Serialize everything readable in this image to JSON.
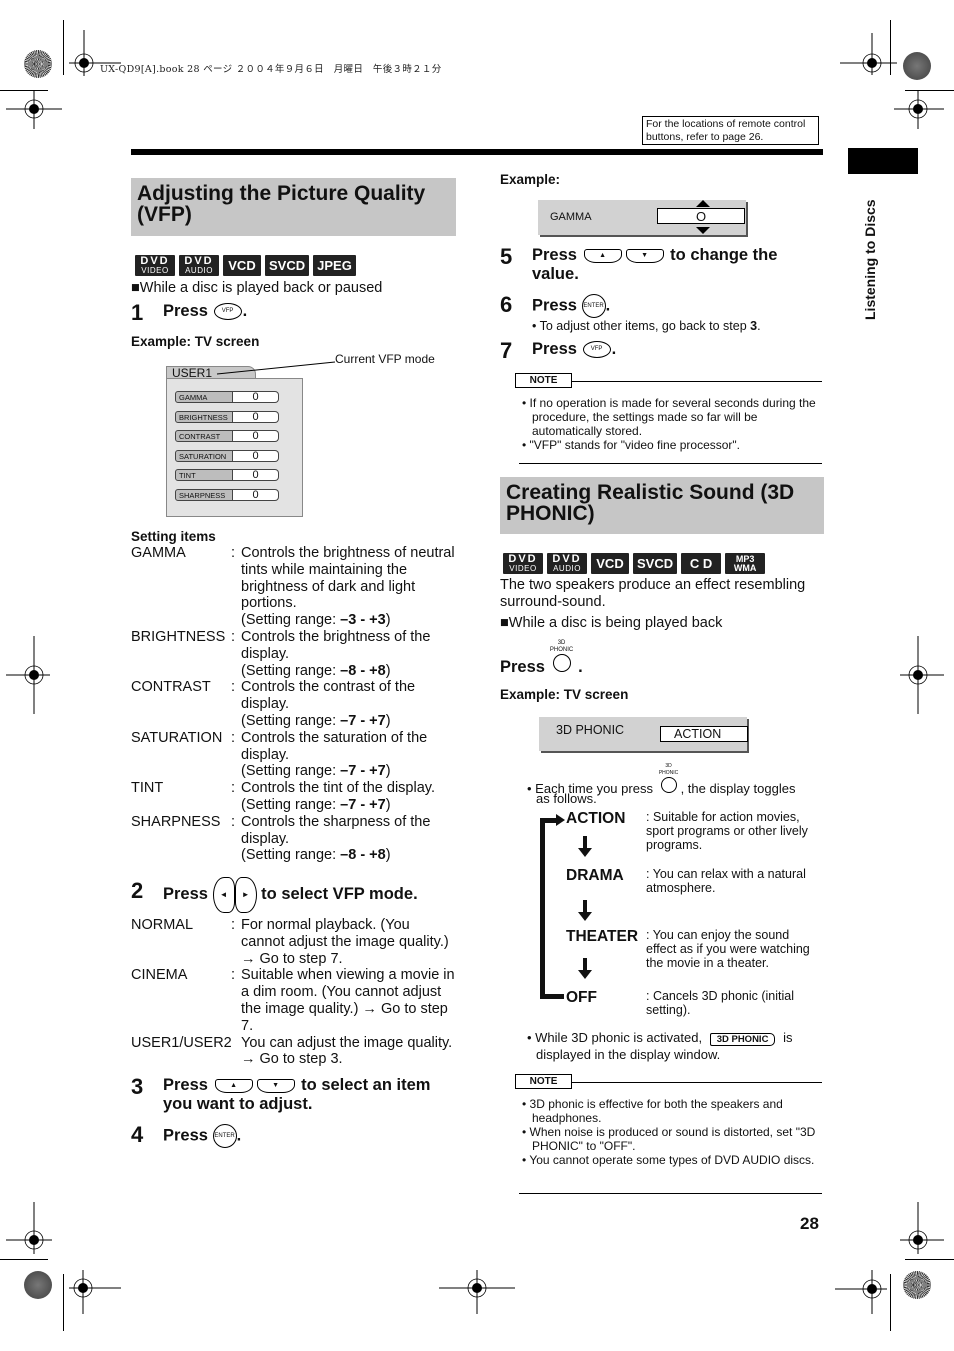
{
  "print_header": "UX-QD9[A].book  28 ページ  ２００４年９月６日　月曜日　午後３時２１分",
  "ref_note": "For the locations of remote control buttons, refer to page 26.",
  "side_label": "Listening to Discs",
  "page_number": "28",
  "vfp": {
    "title": "Adjusting the Picture Quality (VFP)",
    "disc_badges": [
      {
        "top": "DVD",
        "bottom": "VIDEO"
      },
      {
        "top": "DVD",
        "bottom": "AUDIO"
      },
      {
        "label": "VCD"
      },
      {
        "label": "SVCD"
      },
      {
        "label": "JPEG"
      }
    ],
    "condition": "■While a disc is played back or paused",
    "step1": {
      "num": "1",
      "pre": "Press",
      "button": "VFP",
      "post": "."
    },
    "example_label": "Example: TV screen",
    "tv_screen": {
      "mode": "USER1",
      "callout": "Current VFP mode",
      "rows": [
        {
          "name": "GAMMA",
          "value": "0"
        },
        {
          "name": "BRIGHTNESS",
          "value": "0"
        },
        {
          "name": "CONTRAST",
          "value": "0"
        },
        {
          "name": "SATURATION",
          "value": "0"
        },
        {
          "name": "TINT",
          "value": "0"
        },
        {
          "name": "SHARPNESS",
          "value": "0"
        }
      ]
    },
    "setting_items_heading": "Setting items",
    "setting_items": [
      {
        "name": "GAMMA",
        "desc": "Controls the brightness of neutral tints while maintaining the brightness of dark and light portions.",
        "range_prefix": "(Setting range: ",
        "range": "–3 - +3",
        "range_suffix": ")"
      },
      {
        "name": "BRIGHTNESS",
        "desc": "Controls the brightness of the display.",
        "range_prefix": "(Setting range: ",
        "range": "–8 - +8",
        "range_suffix": ")"
      },
      {
        "name": "CONTRAST",
        "desc": "Controls the contrast of the display.",
        "range_prefix": "(Setting range: ",
        "range": "–7 - +7",
        "range_suffix": ")"
      },
      {
        "name": "SATURATION",
        "desc": "Controls the saturation of the display.",
        "range_prefix": "(Setting range: ",
        "range": "–7 - +7",
        "range_suffix": ")"
      },
      {
        "name": "TINT",
        "desc": "Controls the tint of the display.",
        "range_prefix": "(Setting range: ",
        "range": "–7 - +7",
        "range_suffix": ")"
      },
      {
        "name": "SHARPNESS",
        "desc": "Controls the sharpness of the display.",
        "range_prefix": "(Setting range: ",
        "range": "–8 - +8",
        "range_suffix": ")"
      }
    ],
    "step2": {
      "num": "2",
      "pre": "Press",
      "left": "◄",
      "right": "►",
      "post": "to select VFP mode."
    },
    "modes": [
      {
        "name": "NORMAL",
        "desc": "For normal playback. (You cannot adjust the image quality.) → Go to step 7."
      },
      {
        "name": "CINEMA",
        "desc": "Suitable when viewing a movie in a dim room. (You cannot adjust the image quality.) → Go to step 7."
      },
      {
        "name": "USER1/USER2",
        "desc": "You can adjust the image quality. → Go to step 3."
      }
    ],
    "step3": {
      "num": "3",
      "pre": "Press",
      "up": "▲",
      "down": "▼",
      "post": "to select an item you want to adjust."
    },
    "step4": {
      "num": "4",
      "pre": "Press",
      "button": "ENTER",
      "post": "."
    },
    "example2_label": "Example:",
    "gamma_example": {
      "label": "GAMMA",
      "value": "O"
    },
    "step5": {
      "num": "5",
      "pre": "Press",
      "up": "▲",
      "down": "▼",
      "post": "to change the value."
    },
    "step6": {
      "num": "6",
      "pre": "Press",
      "button": "ENTER",
      "post": ".",
      "sub_pre": "• To adjust other items, go back to step ",
      "sub_bold": "3",
      "sub_post": "."
    },
    "step7": {
      "num": "7",
      "pre": "Press",
      "button": "VFP",
      "post": "."
    },
    "note": {
      "tag": "NOTE",
      "items": [
        "If no operation is made for several seconds during the procedure, the settings made so far will be automatically stored.",
        "\"VFP\" stands for \"video fine processor\"."
      ]
    }
  },
  "phonic": {
    "title": "Creating Realistic Sound (3D PHONIC)",
    "disc_badges": [
      {
        "top": "DVD",
        "bottom": "VIDEO"
      },
      {
        "top": "DVD",
        "bottom": "AUDIO"
      },
      {
        "label": "VCD"
      },
      {
        "label": "SVCD"
      },
      {
        "label": "C D"
      },
      {
        "top": "MP3",
        "bottom": "WMA"
      }
    ],
    "intro": "The two speakers produce an effect resembling surround-sound.",
    "condition": "■While a disc is being played back",
    "press": {
      "pre": "Press",
      "button_label": "3D PHONIC",
      "post": "."
    },
    "example_label": "Example: TV screen",
    "tv_screen": {
      "label": "3D PHONIC",
      "value": "ACTION"
    },
    "toggle_pre": "• Each time you press",
    "toggle_post": ", the display toggles",
    "toggle_line2": "as follows.",
    "modes": [
      {
        "name": "ACTION",
        "desc": "Suitable for action movies, sport programs or other lively programs."
      },
      {
        "name": "DRAMA",
        "desc": "You can relax with a natural atmosphere."
      },
      {
        "name": "THEATER",
        "desc": "You can enjoy the sound effect as if you were watching the movie in a theater."
      },
      {
        "name": "OFF",
        "desc": "Cancels 3D phonic (initial setting)."
      }
    ],
    "active_pre": "• While 3D phonic is activated,",
    "active_badge": "3D PHONIC",
    "active_post": "is",
    "active_line2": "displayed in the display window.",
    "note": {
      "tag": "NOTE",
      "items": [
        "3D phonic is effective for both the speakers and headphones.",
        "When noise is produced or sound is distorted, set \"3D PHONIC\" to \"OFF\".",
        "You cannot operate some types of DVD AUDIO discs."
      ]
    }
  }
}
